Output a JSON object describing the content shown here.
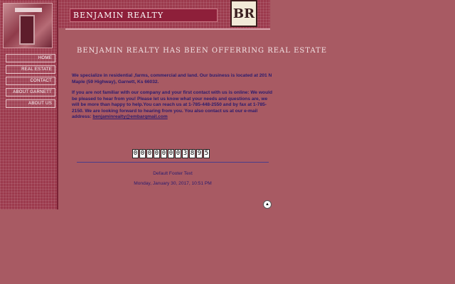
{
  "header": {
    "site_title": "Benjamin Realty",
    "logo_text": "BR"
  },
  "nav": {
    "items": [
      {
        "label": "Home"
      },
      {
        "label": "Real Estate"
      },
      {
        "label": "Contact"
      },
      {
        "label": "About Garnett"
      },
      {
        "label": "About Us"
      }
    ]
  },
  "main": {
    "tagline": "Benjamin Realty has been offerring real estate",
    "paragraph1": "We specialize in residential ,farms, commercial and land. Our business is located at 201 N Maple (59 Highway), Garnett, Ks 66032.",
    "paragraph2": "If you are not familiar with our company and your first contact with us is online: We would be pleased to hear from you! Please let us know what your needs and questions are, we will be more than happy to help.You can reach us at 1-785-448-2550 and by fax at 1-785-2150. We are looking forward to hearing from you. You  also contact us at our e-mail address: ",
    "email": "benjaminrealty@embarqmail.com"
  },
  "counter": {
    "digits": [
      "0",
      "0",
      "0",
      "0",
      "0",
      "0",
      "0",
      "3",
      "8",
      "9",
      "5"
    ]
  },
  "footer": {
    "text": "Default Footer Text",
    "date": "Monday, January 30, 2017, 10:51 PM"
  },
  "icons": {
    "scroll_top": "up-arrow-icon"
  },
  "colors": {
    "background": "#a85a63",
    "sidebar": "#9c3a4d",
    "title_bar": "#8e1f3a",
    "body_text": "#2a1b6e"
  }
}
